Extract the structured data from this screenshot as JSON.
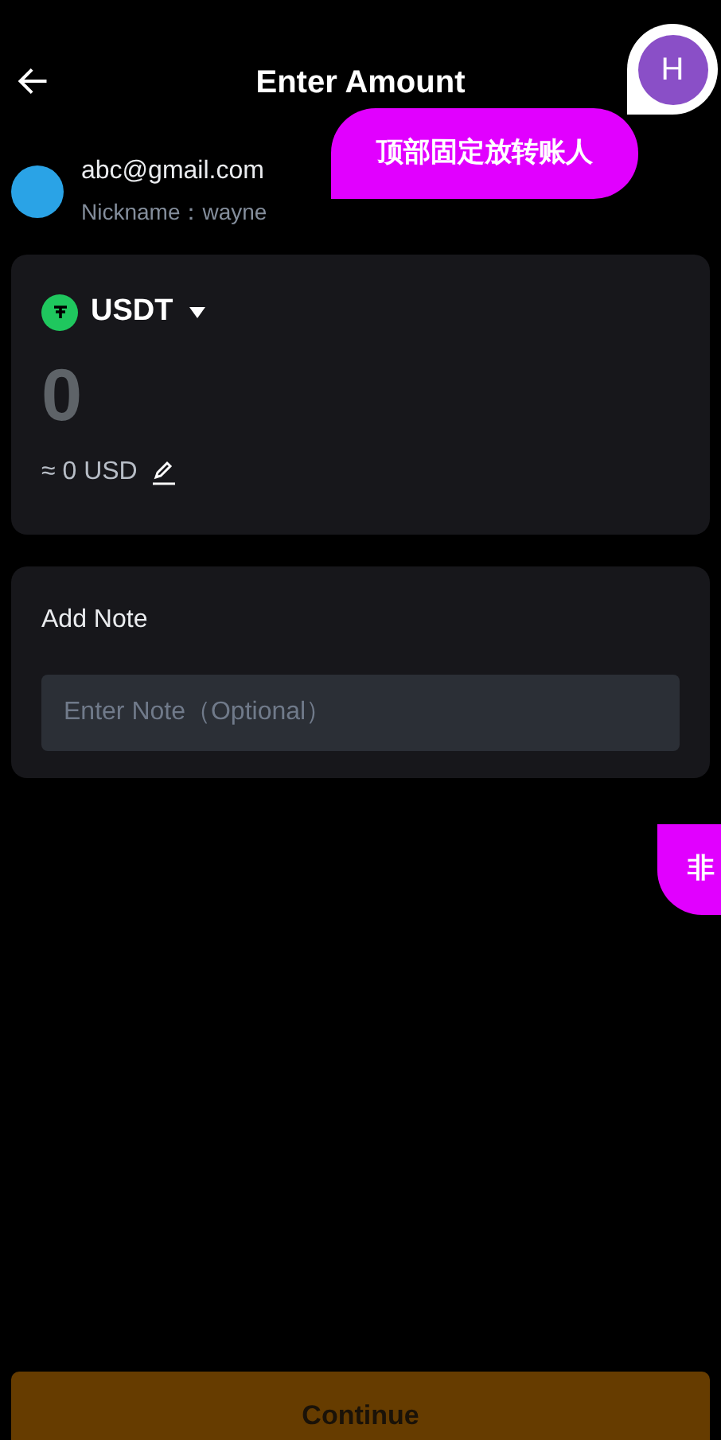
{
  "header": {
    "title": "Enter Amount"
  },
  "recipient": {
    "email": "abc@gmail.com",
    "nickname": "Nickname：wayne"
  },
  "amount_card": {
    "currency": "USDT",
    "amount": "0",
    "conversion": "≈ 0 USD"
  },
  "note_card": {
    "label": "Add Note",
    "placeholder": "Enter Note（Optional）"
  },
  "continue_button": {
    "label": "Continue",
    "disabled": true
  },
  "annotations": [
    {
      "kind": "comment",
      "text": "顶部固定放转账人"
    },
    {
      "kind": "edge",
      "text": "非"
    }
  ],
  "commenter": {
    "initial": "H"
  }
}
